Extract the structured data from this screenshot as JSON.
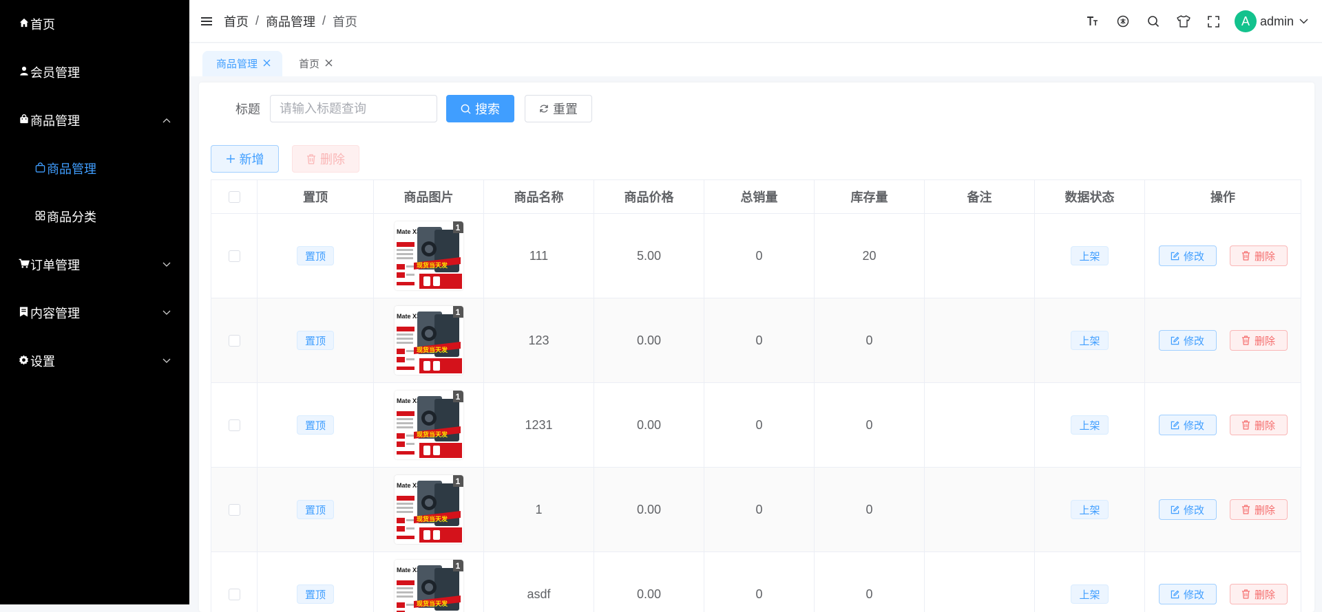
{
  "sidebar": {
    "items": [
      {
        "icon": "home-icon",
        "label": "首页"
      },
      {
        "icon": "user-icon",
        "label": "会员管理"
      },
      {
        "icon": "shopping-bag-icon",
        "label": "商品管理"
      },
      {
        "icon": "shopping-bag-outline-icon",
        "label": "商品管理"
      },
      {
        "icon": "grid-icon",
        "label": "商品分类"
      },
      {
        "icon": "cart-icon",
        "label": "订单管理"
      },
      {
        "icon": "document-icon",
        "label": "内容管理"
      },
      {
        "icon": "gear-icon",
        "label": "设置"
      }
    ]
  },
  "header": {
    "breadcrumb": [
      "首页",
      "商品管理",
      "首页"
    ],
    "separator": "/",
    "user": {
      "avatar_letter": "A",
      "name": "admin"
    },
    "icons": [
      "font-size-icon",
      "language-icon",
      "search-icon",
      "theme-shirt-icon",
      "fullscreen-icon"
    ]
  },
  "tabs": [
    {
      "label": "商品管理",
      "active": true
    },
    {
      "label": "首页",
      "active": false
    }
  ],
  "search": {
    "label": "标题",
    "placeholder": "请输入标题查询",
    "value": "",
    "search_button": "搜索",
    "reset_button": "重置"
  },
  "toolbar": {
    "add_button": "新增",
    "delete_button": "删除"
  },
  "table": {
    "columns": [
      "置顶",
      "商品图片",
      "商品名称",
      "商品价格",
      "总销量",
      "库存量",
      "备注",
      "数据状态",
      "操作"
    ],
    "rows": [
      {
        "top_label": "置顶",
        "image_badge": "1",
        "image_title": "Mate X3",
        "image_banner": "现货当天发",
        "name": "111",
        "price": "5.00",
        "sales": "0",
        "stock": "20",
        "note": "",
        "status": "上架",
        "edit": "修改",
        "delete": "删除"
      },
      {
        "top_label": "置顶",
        "image_badge": "1",
        "image_title": "Mate X3",
        "image_banner": "现货当天发",
        "name": "123",
        "price": "0.00",
        "sales": "0",
        "stock": "0",
        "note": "",
        "status": "上架",
        "edit": "修改",
        "delete": "删除"
      },
      {
        "top_label": "置顶",
        "image_badge": "1",
        "image_title": "Mate X3",
        "image_banner": "现货当天发",
        "name": "1231",
        "price": "0.00",
        "sales": "0",
        "stock": "0",
        "note": "",
        "status": "上架",
        "edit": "修改",
        "delete": "删除"
      },
      {
        "top_label": "置顶",
        "image_badge": "1",
        "image_title": "Mate X3",
        "image_banner": "现货当天发",
        "name": "1",
        "price": "0.00",
        "sales": "0",
        "stock": "0",
        "note": "",
        "status": "上架",
        "edit": "修改",
        "delete": "删除"
      },
      {
        "top_label": "置顶",
        "image_badge": "1",
        "image_title": "Mate X3",
        "image_banner": "现货当天发",
        "name": "asdf",
        "price": "0.00",
        "sales": "0",
        "stock": "0",
        "note": "",
        "status": "上架",
        "edit": "修改",
        "delete": "删除"
      }
    ]
  },
  "colors": {
    "primary": "#409eff",
    "danger": "#f56c6c",
    "sidebar_bg": "#000000",
    "avatar": "#13c28d"
  }
}
